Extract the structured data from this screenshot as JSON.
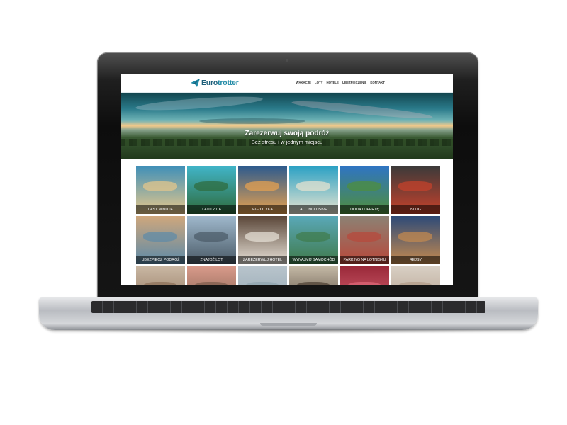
{
  "header": {
    "logo_part1": "Euro",
    "logo_part2": "trotter",
    "nav": [
      "WAKACJE",
      "LOTY",
      "HOTELE",
      "UBEZPIECZENIE",
      "KONTAKT"
    ]
  },
  "hero": {
    "title": "Zarezerwuj swoją podróż",
    "subtitle": "Bez stresu i w jednym miejscu"
  },
  "tiles": [
    {
      "label": "LAST MINUTE",
      "bg": "#3f8fb8",
      "accent": "#e8c88a"
    },
    {
      "label": "LATO 2016",
      "bg": "#41b5c9",
      "accent": "#2e6a3a"
    },
    {
      "label": "EGZOTYKA",
      "bg": "#2c5a8e",
      "accent": "#e9a24e"
    },
    {
      "label": "ALL INCLUSIVE",
      "bg": "#2aa0c4",
      "accent": "#e9e4d0"
    },
    {
      "label": "DODAJ OFERTĘ",
      "bg": "#2f74c4",
      "accent": "#4f8f3a"
    },
    {
      "label": "BLOG",
      "bg": "#3a3a3a",
      "accent": "#c8412b"
    },
    {
      "label": "UBEZPIECZ PODRÓŻ",
      "bg": "#cfa77c",
      "accent": "#5c8aa8"
    },
    {
      "label": "ZNAJDŹ LOT",
      "bg": "#9fb8cc",
      "accent": "#4a5a66"
    },
    {
      "label": "ZAREZERWUJ HOTEL",
      "bg": "#5a4638",
      "accent": "#e8e2d8"
    },
    {
      "label": "WYNAJMIJ SAMOCHÓD",
      "bg": "#5aa8b8",
      "accent": "#3f7a4a"
    },
    {
      "label": "PARKING NA LOTNISKU",
      "bg": "#8c8274",
      "accent": "#b8473a"
    },
    {
      "label": "REJSY",
      "bg": "#2d4a78",
      "accent": "#c68a4e"
    },
    {
      "label": "",
      "bg": "#c9b7a3",
      "accent": "#8a6d55"
    },
    {
      "label": "",
      "bg": "#d89a8a",
      "accent": "#7a5a4a"
    },
    {
      "label": "",
      "bg": "#b8c4cc",
      "accent": "#8fa2ad"
    },
    {
      "label": "",
      "bg": "#c4b9a6",
      "accent": "#4a3c30"
    },
    {
      "label": "",
      "bg": "#9a2a3a",
      "accent": "#e06a7a"
    },
    {
      "label": "",
      "bg": "#d8cfc4",
      "accent": "#b09a86"
    }
  ],
  "colors": {
    "brand_dark": "#1e5f7a",
    "brand_light": "#1f8aa6",
    "tile_label_bg": "rgba(0,0,0,0.55)"
  }
}
